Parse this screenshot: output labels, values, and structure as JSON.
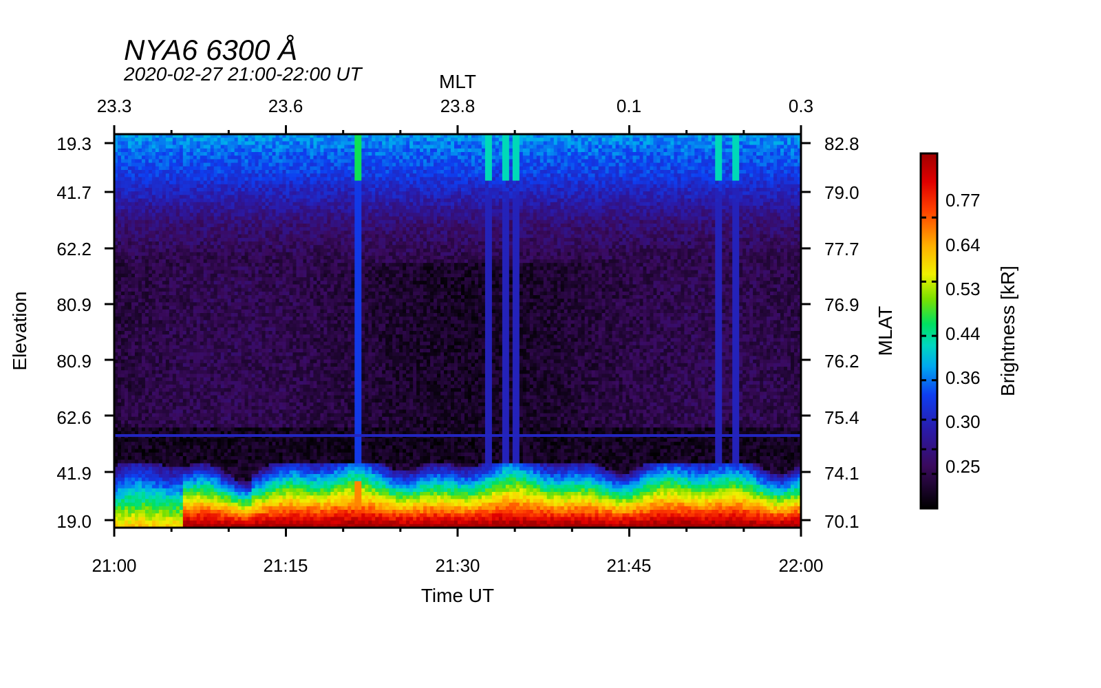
{
  "chart_data": {
    "type": "heatmap",
    "title": "NYA6 6300 Å",
    "subtitle": "2020-02-27 21:00-22:00 UT",
    "xlabel": "Time UT",
    "top_xlabel": "MLT",
    "ylabel": "Elevation",
    "right_ylabel": "MLAT",
    "colorbar_label": "Brightness [kR]",
    "x_ticks": [
      "21:00",
      "21:15",
      "21:30",
      "21:45",
      "22:00"
    ],
    "top_x_ticks": [
      "23.3",
      "23.6",
      "23.8",
      "0.1",
      "0.3"
    ],
    "y_ticks_left": [
      "19.3",
      "41.7",
      "62.2",
      "80.9",
      "80.9",
      "62.6",
      "41.9",
      "19.0"
    ],
    "y_ticks_right": [
      "82.8",
      "79.0",
      "77.7",
      "76.9",
      "76.2",
      "75.4",
      "74.1",
      "70.1"
    ],
    "colorbar_ticks": [
      "0.77",
      "0.64",
      "0.53",
      "0.44",
      "0.36",
      "0.30",
      "0.25"
    ],
    "colorbar_tick_values": [
      0.77,
      0.64,
      0.53,
      0.44,
      0.36,
      0.3,
      0.25
    ],
    "colorbar_range": [
      0.18,
      0.9
    ],
    "colormap": [
      "#000000",
      "#3a0a5e",
      "#2a1aa8",
      "#0e3ef0",
      "#00a8f0",
      "#00d8c0",
      "#00e060",
      "#7ae000",
      "#f0f000",
      "#ffb000",
      "#ff4000",
      "#e00000",
      "#a00000"
    ],
    "x_range": [
      "21:00",
      "22:00"
    ],
    "time_range_minutes": [
      0,
      60
    ],
    "features": {
      "vertical_streaks_minutes": [
        21.4,
        32.7,
        34.3,
        35.1,
        52.9,
        54.2
      ],
      "horizontal_line_level": 0.36
    }
  }
}
